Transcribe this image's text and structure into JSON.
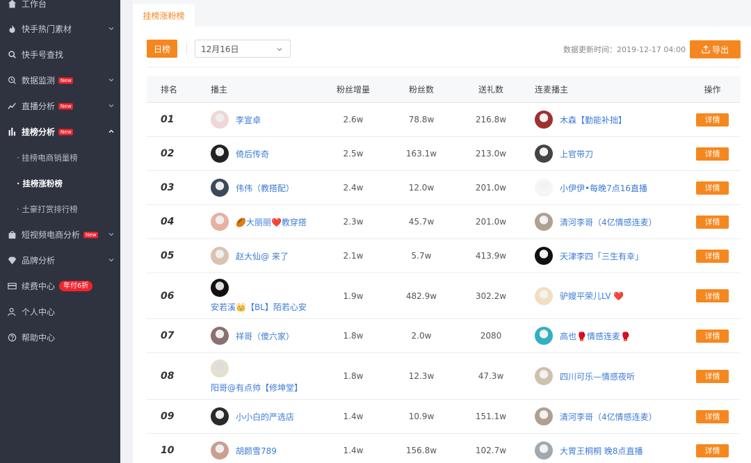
{
  "sidebar": {
    "items": [
      {
        "label": "工作台",
        "icon": "home-icon"
      },
      {
        "label": "快手热门素材",
        "icon": "fire-icon"
      },
      {
        "label": "快手号查找",
        "icon": "search-icon"
      },
      {
        "label": "数据监测",
        "icon": "monitor-icon",
        "badge": "New"
      },
      {
        "label": "直播分析",
        "icon": "trend-icon",
        "badge": "New"
      },
      {
        "label": "挂榜分析",
        "icon": "bar-chart-icon",
        "badge": "New"
      },
      {
        "label": "短视频电商分析",
        "icon": "bag-icon",
        "badge": "New"
      },
      {
        "label": "品牌分析",
        "icon": "diamond-icon"
      },
      {
        "label": "续费中心",
        "icon": "card-icon",
        "promo": "年付6折"
      },
      {
        "label": "个人中心",
        "icon": "user-icon"
      },
      {
        "label": "帮助中心",
        "icon": "help-icon"
      }
    ],
    "subitems": [
      {
        "label": "· 挂榜电商销量榜"
      },
      {
        "label": "· 挂榜涨粉榜"
      },
      {
        "label": "· 土豪打赏排行榜"
      }
    ]
  },
  "tab": {
    "label": "挂榜涨粉榜"
  },
  "toolbar": {
    "day_button": "日榜",
    "date_value": "12月16日",
    "update_label": "数据更新时间：",
    "update_time": "2019-12-17 04:00",
    "export_button": "导出"
  },
  "table": {
    "headers": [
      "排名",
      "播主",
      "粉丝增量",
      "粉丝数",
      "送礼数",
      "连麦播主",
      "操作"
    ],
    "detail_label": "详情",
    "rows": [
      {
        "rank": "01",
        "anchor": "李宣卓",
        "gain": "2.6w",
        "fans": "78.8w",
        "gifts": "216.8w",
        "partner": "木森【勤能补拙】"
      },
      {
        "rank": "02",
        "anchor": "倚后传奇",
        "gain": "2.5w",
        "fans": "163.1w",
        "gifts": "213.0w",
        "partner": "上官带刀"
      },
      {
        "rank": "03",
        "anchor": "伟伟（教搭配）",
        "gain": "2.4w",
        "fans": "12.0w",
        "gifts": "201.0w",
        "partner": "小伊伊•每晚7点16直播"
      },
      {
        "rank": "04",
        "anchor": "🏉大丽丽❤️教穿搭",
        "gain": "2.3w",
        "fans": "45.7w",
        "gifts": "201.0w",
        "partner": "清河李哥（4亿情感连麦）"
      },
      {
        "rank": "05",
        "anchor": "赵大仙@ 来了",
        "gain": "2.1w",
        "fans": "5.7w",
        "gifts": "413.9w",
        "partner": "天津李四「三生有幸」"
      },
      {
        "rank": "06",
        "anchor": "安若溪👑【BL】陌若心安",
        "gain": "1.9w",
        "fans": "482.9w",
        "gifts": "302.2w",
        "partner": "驴嫂平荣儿LV ❤️"
      },
      {
        "rank": "07",
        "anchor": "祥哥（傻六家）",
        "gain": "1.8w",
        "fans": "2.0w",
        "gifts": "2080",
        "partner": "高也🥊情感连麦🥊"
      },
      {
        "rank": "08",
        "anchor": "阳哥@有点帅【修坤堂】",
        "gain": "1.8w",
        "fans": "12.3w",
        "gifts": "47.3w",
        "partner": "四川可乐—情感夜听"
      },
      {
        "rank": "09",
        "anchor": "小小白的严选店",
        "gain": "1.4w",
        "fans": "10.9w",
        "gifts": "151.1w",
        "partner": "清河李哥（4亿情感连麦）"
      },
      {
        "rank": "10",
        "anchor": "胡颜雪789",
        "gain": "1.4w",
        "fans": "156.8w",
        "gifts": "102.7w",
        "partner": "大胃王桐桐 晚8点直播"
      }
    ]
  },
  "colors": {
    "accent": "#f5871f",
    "sidebar_bg": "#2f3340",
    "link": "#3c7bd6",
    "badge_red": "#f5222d"
  }
}
